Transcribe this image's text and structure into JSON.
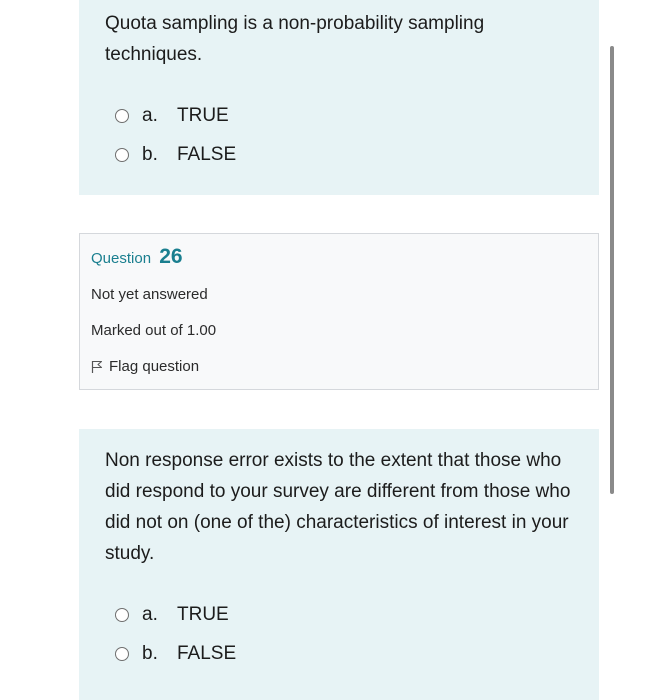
{
  "question25": {
    "text": "Quota sampling is a non-probability sampling techniques.",
    "options": [
      {
        "letter": "a.",
        "label": "TRUE"
      },
      {
        "letter": "b.",
        "label": "FALSE"
      }
    ]
  },
  "question26_info": {
    "label": "Question",
    "number": "26",
    "status": "Not yet answered",
    "marks": "Marked out of 1.00",
    "flag_label": "Flag question"
  },
  "question26": {
    "text": "Non response error exists to the extent that those who did respond to your survey are different from those who did not on (one of the) characteristics of interest in your study.",
    "options": [
      {
        "letter": "a.",
        "label": "TRUE"
      },
      {
        "letter": "b.",
        "label": "FALSE"
      }
    ]
  },
  "colors": {
    "qtext_bg": "#e7f3f5",
    "info_bg": "#f8f9fa",
    "accent": "#1a7f8f"
  }
}
